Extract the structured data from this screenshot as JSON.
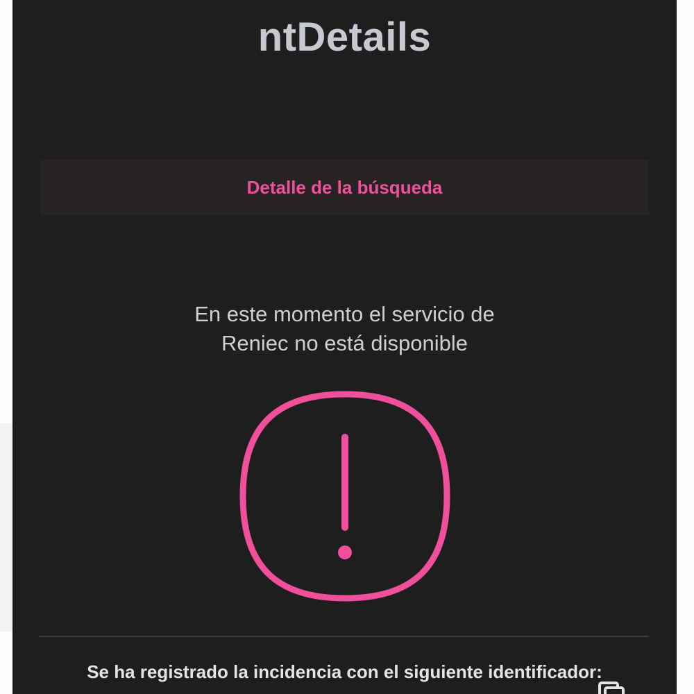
{
  "page": {
    "title": "ntDetails"
  },
  "section": {
    "header_label": "Detalle de la búsqueda"
  },
  "status": {
    "message_line1": "En este momento el servicio de",
    "message_line2": "Reniec no está disponible",
    "icon": "alert-circle-icon"
  },
  "incident": {
    "label": "Se ha registrado la incidencia con el siguiente identificador:",
    "copy_icon": "copy-icon"
  },
  "colors": {
    "panel_background": "#1f1e1f",
    "accent": "#f0509b",
    "title_text": "#c7c9d1",
    "body_text": "#cfcfcf"
  }
}
